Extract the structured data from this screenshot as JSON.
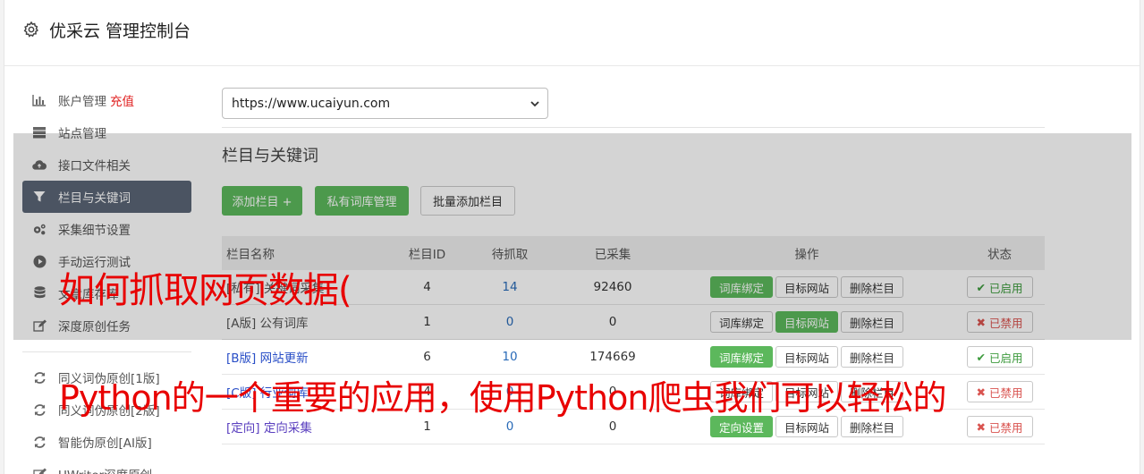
{
  "header": {
    "title": "优采云 管理控制台"
  },
  "sidebar": {
    "items": [
      {
        "label": "账户管理",
        "extra": "充值",
        "icon": "bar-chart-icon"
      },
      {
        "label": "站点管理",
        "icon": "server-icon"
      },
      {
        "label": "接口文件相关",
        "icon": "cloud-upload-icon"
      },
      {
        "label": "栏目与关键词",
        "icon": "filter-icon",
        "active": true
      },
      {
        "label": "采集细节设置",
        "icon": "cogs-icon"
      },
      {
        "label": "手动运行测试",
        "icon": "play-icon"
      },
      {
        "label": "文章库存库",
        "icon": "database-icon"
      },
      {
        "label": "深度原创任务",
        "icon": "edit-icon"
      }
    ],
    "items2": [
      {
        "label": "同义词伪原创[1版]",
        "icon": "refresh-icon"
      },
      {
        "label": "同义词伪原创[2版]",
        "icon": "refresh-icon"
      },
      {
        "label": "智能伪原创[AI版]",
        "icon": "refresh-icon"
      },
      {
        "label": "UWriter深度原创",
        "icon": "edit-icon"
      }
    ]
  },
  "site_select": {
    "value": "https://www.ucaiyun.com"
  },
  "section": {
    "title": "栏目与关键词",
    "add_column": "添加栏目 +",
    "private_lib": "私有词库管理",
    "batch_add": "批量添加栏目"
  },
  "table": {
    "headers": {
      "name": "栏目名称",
      "id": "栏目ID",
      "pending": "待抓取",
      "collected": "已采集",
      "ops": "操作",
      "status": "状态"
    },
    "rows": [
      {
        "name": "[私有] 关键词采集",
        "id": "4",
        "pending": "14",
        "collected": "92460",
        "op1": "词库绑定",
        "op2": "目标网站",
        "op3": "删除栏目",
        "status": "已启用",
        "enabled": true
      },
      {
        "name": "[A版] 公有词库",
        "id": "1",
        "pending": "0",
        "collected": "0",
        "op1": "词库绑定",
        "op2": "目标网站",
        "op3": "删除栏目",
        "status": "已禁用",
        "enabled": false
      },
      {
        "name": "[B版] 网站更新",
        "id": "6",
        "pending": "10",
        "collected": "174669",
        "op1": "词库绑定",
        "op2": "目标网站",
        "op3": "删除栏目",
        "status": "已启用",
        "enabled": true
      },
      {
        "name": "[C版] 行业词库",
        "id": "4",
        "pending": "0",
        "collected": "0",
        "op1": "词库绑定",
        "op2": "目标网站",
        "op3": "删除栏目",
        "status": "已禁用",
        "enabled": false
      },
      {
        "name": "[定向] 定向采集",
        "id": "1",
        "pending": "0",
        "collected": "0",
        "op1": "定向设置",
        "op2": "目标网站",
        "op3": "删除栏目",
        "status": "已禁用",
        "enabled": false
      }
    ]
  },
  "captions": {
    "line1": "如何抓取网页数据(",
    "line2": "Python的一个重要的应用，使用Python爬虫我们可以轻松的"
  },
  "colors": {
    "accent_green": "#5cb85c",
    "active_nav": "#5b6676",
    "caption_red": "#e80000"
  }
}
